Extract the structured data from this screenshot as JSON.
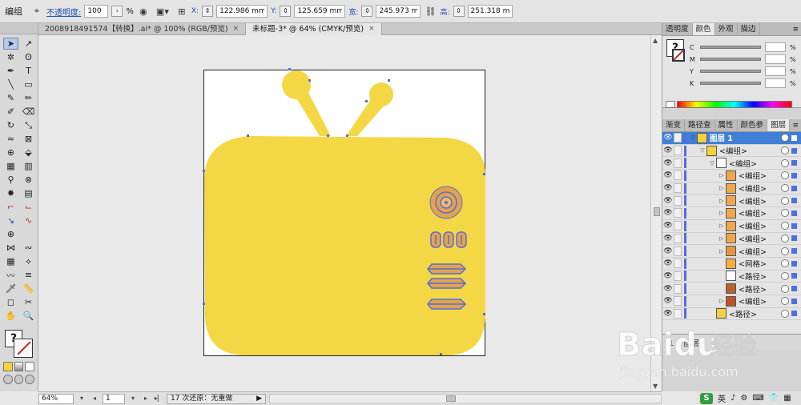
{
  "control_bar": {
    "selection_label": "编组",
    "opacity_label": "不透明度:",
    "opacity_value": "100",
    "opacity_unit": "%",
    "x_label": "X:",
    "x_value": "122.986 mm",
    "y_label": "Y:",
    "y_value": "125.659 mm",
    "width_label": "宽:",
    "width_value": "245.973 m",
    "height_label": "高:",
    "height_value": "251.318 m"
  },
  "doc_tabs": [
    {
      "label": "2008918491574【转换】.ai* @ 100% (RGB/预览)",
      "close": "×"
    },
    {
      "label": "未标题-3* @ 64% (CMYK/预览)",
      "close": "×"
    }
  ],
  "status_bar": {
    "zoom": "64%",
    "artboard": "1",
    "status_text": "17 次还原：无重做"
  },
  "color_panel": {
    "tabs": [
      "透明度",
      "颜色",
      "外观",
      "描边"
    ],
    "active_tab": "颜色",
    "channels": [
      "C",
      "M",
      "Y",
      "K"
    ],
    "percent": "%"
  },
  "layers_panel": {
    "tabs": [
      "渐变",
      "路径查",
      "属性",
      "颜色参",
      "图层"
    ],
    "active_tab": "图层",
    "footer_text": "1 个图层",
    "rows": [
      {
        "name": "图层 1",
        "level": 0,
        "expanded": true,
        "selected": true,
        "thumb": "#f5d23c"
      },
      {
        "name": "<编组>",
        "level": 1,
        "expanded": true,
        "selected": false,
        "thumb": "#f5d23c"
      },
      {
        "name": "<编组>",
        "level": 2,
        "expanded": true,
        "selected": false,
        "thumb": "#ffffff"
      },
      {
        "name": "<编组>",
        "level": 3,
        "expanded": false,
        "selected": false,
        "thumb": "#f0a64a"
      },
      {
        "name": "<编组>",
        "level": 3,
        "expanded": false,
        "selected": false,
        "thumb": "#f0a64a"
      },
      {
        "name": "<编组>",
        "level": 3,
        "expanded": false,
        "selected": false,
        "thumb": "#f0a64a"
      },
      {
        "name": "<编组>",
        "level": 3,
        "expanded": false,
        "selected": false,
        "thumb": "#f0a64a"
      },
      {
        "name": "<编组>",
        "level": 3,
        "expanded": false,
        "selected": false,
        "thumb": "#f0a64a"
      },
      {
        "name": "<编组>",
        "level": 3,
        "expanded": false,
        "selected": false,
        "thumb": "#f0a64a"
      },
      {
        "name": "<编组>",
        "level": 3,
        "expanded": false,
        "selected": false,
        "thumb": "#e8953a"
      },
      {
        "name": "<网格>",
        "level": 3,
        "expanded": null,
        "selected": false,
        "thumb": "#f5b040"
      },
      {
        "name": "<路径>",
        "level": 3,
        "expanded": null,
        "selected": false,
        "thumb": "#ffffff"
      },
      {
        "name": "<路径>",
        "level": 3,
        "expanded": null,
        "selected": false,
        "thumb": "#b8622e"
      },
      {
        "name": "<编组>",
        "level": 3,
        "expanded": false,
        "selected": false,
        "thumb": "#c0502a"
      },
      {
        "name": "<路径>",
        "level": 2,
        "expanded": null,
        "selected": false,
        "thumb": "#f5d23c"
      }
    ]
  },
  "ime": {
    "logo": "S",
    "items": [
      "英",
      "♪",
      "⚙",
      "⌨",
      "👕",
      "▦"
    ]
  },
  "watermark": {
    "brand": "Baidu",
    "suffix": "经验",
    "url": "jingyan.baidu.com"
  },
  "colors": {
    "tv_body": "#f4d745",
    "knob": "#e6a24a",
    "selection": "#4f6fe0",
    "layer_selected": "#3f7fd6"
  }
}
